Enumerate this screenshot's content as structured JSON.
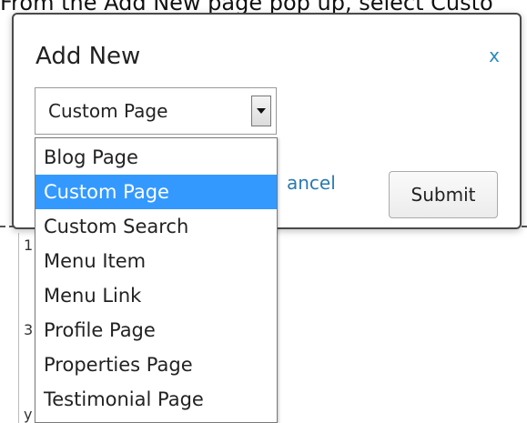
{
  "background": {
    "caption": "From the Add New page pop up, select Custo",
    "marks": [
      "1",
      "3",
      "y"
    ]
  },
  "modal": {
    "title": "Add New",
    "close_label": "x",
    "select_value": "Custom Page",
    "cancel_label": "ancel",
    "submit_label": "Submit"
  },
  "dropdown": {
    "options": [
      {
        "label": "Blog Page",
        "selected": false
      },
      {
        "label": "Custom Page",
        "selected": true
      },
      {
        "label": "Custom Search",
        "selected": false
      },
      {
        "label": "Menu Item",
        "selected": false
      },
      {
        "label": "Menu Link",
        "selected": false
      },
      {
        "label": "Profile Page",
        "selected": false
      },
      {
        "label": "Properties Page",
        "selected": false
      },
      {
        "label": "Testimonial Page",
        "selected": false
      }
    ]
  },
  "colors": {
    "highlight": "#3399ff",
    "link": "#2a7ab0"
  },
  "icons": {
    "select_arrow": "caret-down-icon"
  }
}
